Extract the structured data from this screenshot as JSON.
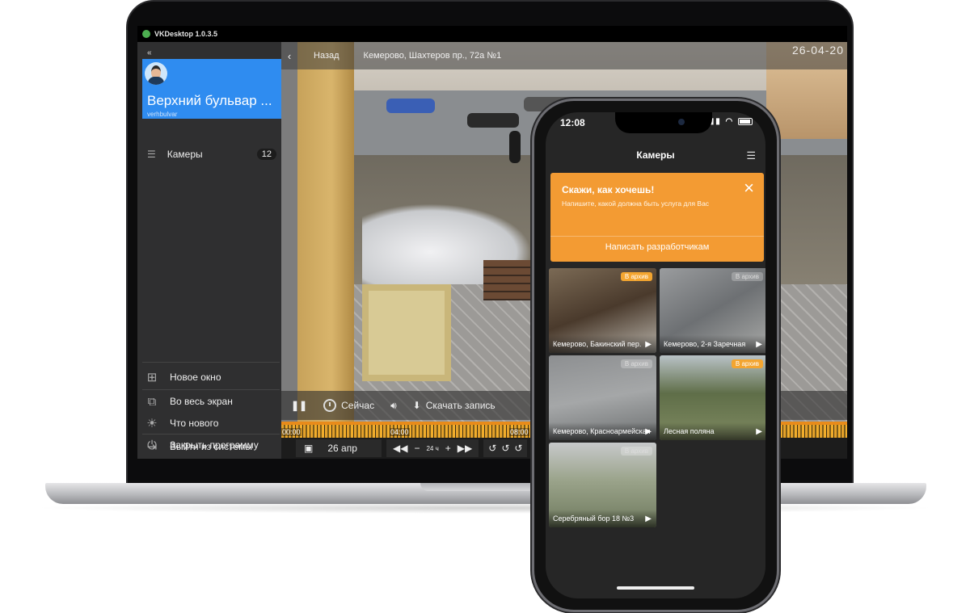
{
  "desktop": {
    "app_title": "VKDesktop 1.0.3.5",
    "collapse_icon": "«",
    "profile": {
      "name": "Верхний бульвар ...",
      "login": "verhbulvar"
    },
    "menu": {
      "cameras_label": "Камеры",
      "cameras_count": "12"
    },
    "bottom_menu": [
      {
        "icon": "plus-square-icon",
        "label": "Новое окно"
      },
      {
        "icon": "external-window-icon",
        "label": "Во весь экран"
      },
      {
        "icon": "sun-icon",
        "label": "Что нового"
      },
      {
        "icon": "logout-icon",
        "label": "Выйти из системы"
      },
      {
        "icon": "power-icon",
        "label": "Закрыть программу"
      }
    ],
    "player": {
      "back_label": "Назад",
      "camera_title": "Кемерово, Шахтеров пр., 72а №1",
      "timestamp": "26-04-20",
      "controls": {
        "now": "Сейчас",
        "download": "Скачать запись"
      },
      "timeline_labels": [
        "00:00",
        "04:00",
        "08:00"
      ],
      "date": "26 апр",
      "zoom": "24 ч"
    }
  },
  "mobile": {
    "status_time": "12:08",
    "header_title": "Камеры",
    "promo": {
      "title": "Скажи, как хочешь!",
      "subtitle": "Напишите, какой должна быть услуга для Вас",
      "button": "Написать разработчикам"
    },
    "cameras": [
      {
        "name": "Кемерово, Бакинский пер.",
        "badge": "В архив",
        "badge_active": true
      },
      {
        "name": "Кемерово, 2-я Заречная",
        "badge": "В архив",
        "badge_active": false
      },
      {
        "name": "Кемерово, Красноармейская",
        "badge": "В архив",
        "badge_active": false
      },
      {
        "name": "Лесная поляна",
        "badge": "В архив",
        "badge_active": true
      },
      {
        "name": "Серебряный бор 18 №3",
        "badge": "В архив",
        "badge_active": false
      }
    ]
  },
  "colors": {
    "accent_blue": "#2f8cf0",
    "accent_orange": "#f39b33"
  }
}
